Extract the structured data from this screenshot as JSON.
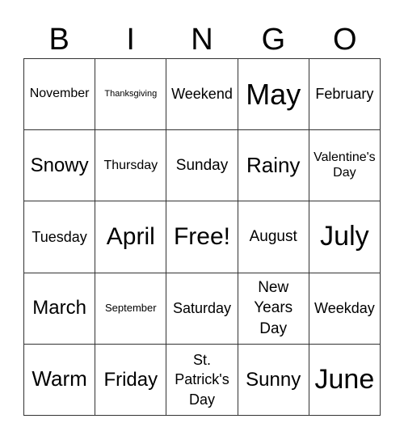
{
  "header": [
    "B",
    "I",
    "N",
    "G",
    "O"
  ],
  "cells": [
    [
      "November",
      "Thanksgiving",
      "Weekend",
      "May",
      "February"
    ],
    [
      "Snowy",
      "Thursday",
      "Sunday",
      "Rainy",
      "Valentine's Day"
    ],
    [
      "Tuesday",
      "April",
      "Free!",
      "August",
      "July"
    ],
    [
      "March",
      "September",
      "Saturday",
      "New Years Day",
      "Weekday"
    ],
    [
      "Warm",
      "Friday",
      "St. Patrick's Day",
      "Sunny",
      "June"
    ]
  ]
}
